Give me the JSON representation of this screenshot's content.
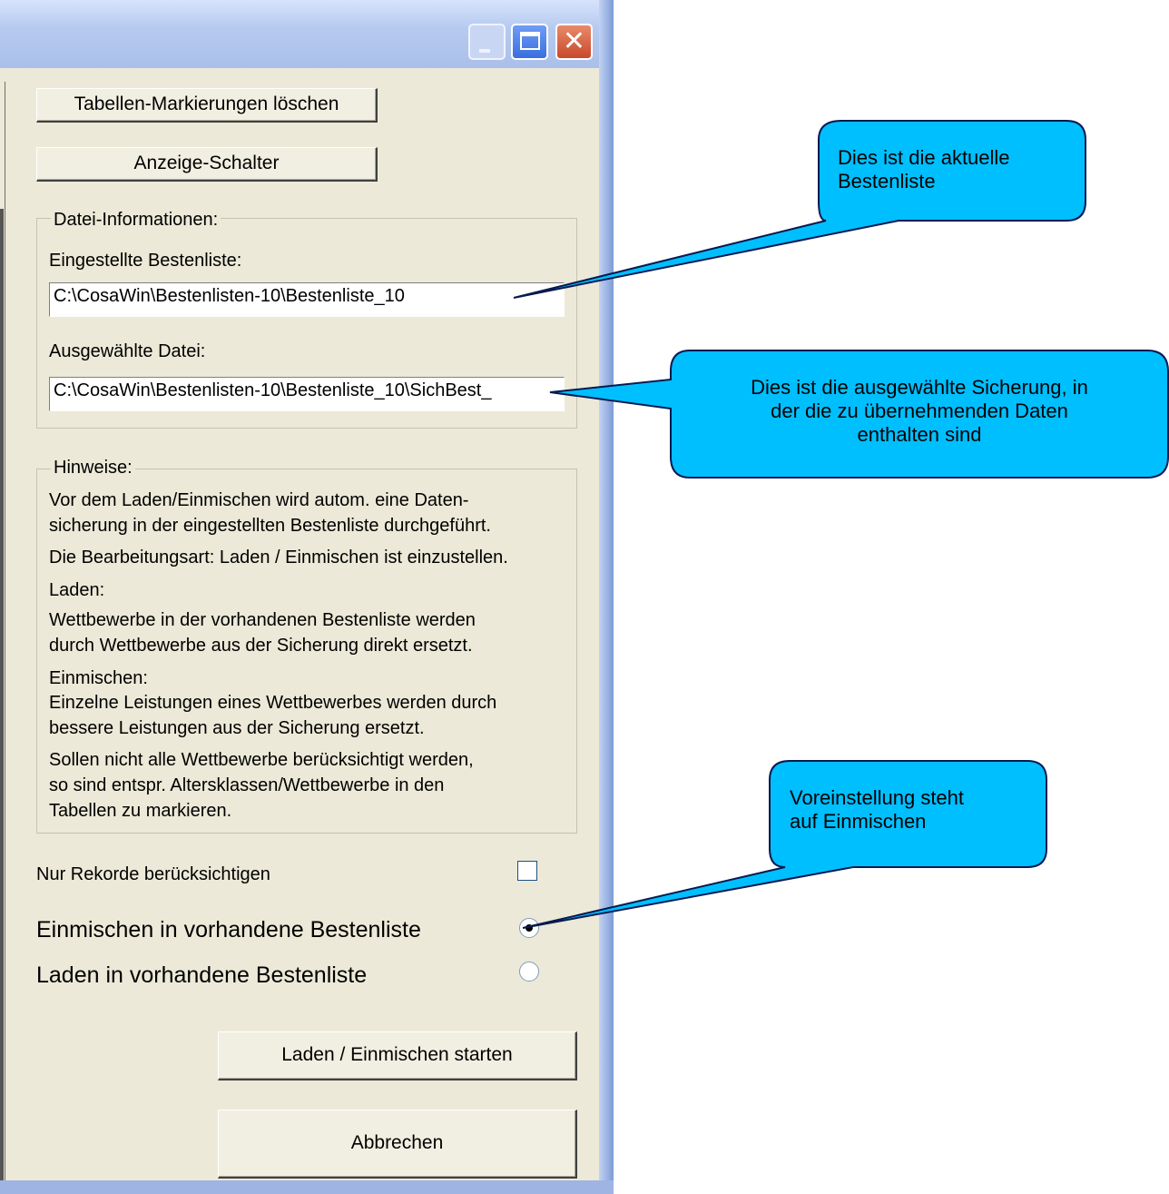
{
  "window": {
    "titlebar_buttons": {
      "minimize_icon": "minimize-icon",
      "maximize_icon": "maximize-icon",
      "close_icon": "close-icon",
      "close_glyph": "✕"
    }
  },
  "buttons": {
    "clear_marks": "Tabellen-Markierungen löschen",
    "display_switch": "Anzeige-Schalter",
    "start": "Laden / Einmischen starten",
    "cancel": "Abbrechen"
  },
  "file_info": {
    "group_label": "Datei-Informationen:",
    "current_label": "Eingestellte Bestenliste:",
    "current_value": "C:\\CosaWin\\Bestenlisten-10\\Bestenliste_10",
    "selected_label": "Ausgewählte Datei:",
    "selected_value": "C:\\CosaWin\\Bestenlisten-10\\Bestenliste_10\\SichBest_"
  },
  "hints": {
    "group_label": "Hinweise:",
    "lines": [
      "Vor dem Laden/Einmischen wird autom. eine Daten-",
      "sicherung in der eingestellten Bestenliste durchgeführt.",
      "Die Bearbeitungsart: Laden / Einmischen ist einzustellen.",
      "Laden:",
      "Wettbewerbe in der vorhandenen Bestenliste werden",
      "durch Wettbewerbe aus der Sicherung direkt ersetzt.",
      "Einmischen:",
      "Einzelne Leistungen eines Wettbewerbes werden durch",
      "bessere Leistungen aus der Sicherung ersetzt.",
      "Sollen nicht alle Wettbewerbe berücksichtigt werden,",
      "so sind entspr. Altersklassen/Wettbewerbe in den",
      "Tabellen zu markieren."
    ]
  },
  "options": {
    "records_only_label": "Nur Rekorde berücksichtigen",
    "records_only_checked": false,
    "merge_label": "Einmischen in vorhandene Bestenliste",
    "merge_selected": true,
    "load_label": "Laden in vorhandene Bestenliste",
    "load_selected": false
  },
  "callouts": {
    "current": [
      "Dies ist die aktuelle",
      "Bestenliste"
    ],
    "selected": [
      "Dies ist die ausgewählte Sicherung, in",
      "der die zu übernehmenden Daten",
      "enthalten sind"
    ],
    "default": [
      "Voreinstellung steht",
      "auf Einmischen"
    ],
    "fill_color": "#00bfff",
    "border_color": "#0a1a50"
  }
}
